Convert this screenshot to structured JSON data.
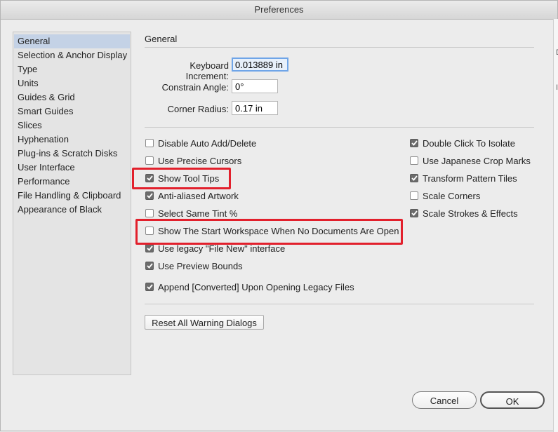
{
  "window": {
    "title": "Preferences"
  },
  "right_strip": [
    "D",
    "I"
  ],
  "sidebar": {
    "items": [
      {
        "label": "General",
        "selected": true
      },
      {
        "label": "Selection & Anchor Display"
      },
      {
        "label": "Type"
      },
      {
        "label": "Units"
      },
      {
        "label": "Guides & Grid"
      },
      {
        "label": "Smart Guides"
      },
      {
        "label": "Slices"
      },
      {
        "label": "Hyphenation"
      },
      {
        "label": "Plug-ins & Scratch Disks"
      },
      {
        "label": "User Interface"
      },
      {
        "label": "Performance"
      },
      {
        "label": "File Handling & Clipboard"
      },
      {
        "label": "Appearance of Black"
      }
    ]
  },
  "general": {
    "title": "General",
    "fields": {
      "keyboard_increment": {
        "label": "Keyboard Increment:",
        "value": "0.013889 in"
      },
      "constrain_angle": {
        "label": "Constrain Angle:",
        "value": "0°"
      },
      "corner_radius": {
        "label": "Corner Radius:",
        "value": "0.17 in"
      }
    },
    "left_options": [
      {
        "label": "Disable Auto Add/Delete",
        "checked": false
      },
      {
        "label": "Use Precise Cursors",
        "checked": false
      },
      {
        "label": "Show Tool Tips",
        "checked": true
      },
      {
        "label": "Anti-aliased Artwork",
        "checked": true
      },
      {
        "label": "Select Same Tint %",
        "checked": false
      },
      {
        "label": "Show The Start Workspace When No Documents Are Open",
        "checked": false
      },
      {
        "label": "Use legacy \"File New\" interface",
        "checked": true
      },
      {
        "label": "Use Preview Bounds",
        "checked": true
      },
      {
        "label": "Append [Converted] Upon Opening Legacy Files",
        "checked": true
      }
    ],
    "right_options": [
      {
        "label": "Double Click To Isolate",
        "checked": true
      },
      {
        "label": "Use Japanese Crop Marks",
        "checked": false
      },
      {
        "label": "Transform Pattern Tiles",
        "checked": true
      },
      {
        "label": "Scale Corners",
        "checked": false
      },
      {
        "label": "Scale Strokes & Effects",
        "checked": true
      }
    ],
    "reset_button": "Reset All Warning Dialogs"
  },
  "footer": {
    "cancel": "Cancel",
    "ok": "OK"
  },
  "colors": {
    "highlight": "#e2202c",
    "selected_sidebar": "#c4d2e6",
    "focus_ring": "#6fa5e8"
  }
}
